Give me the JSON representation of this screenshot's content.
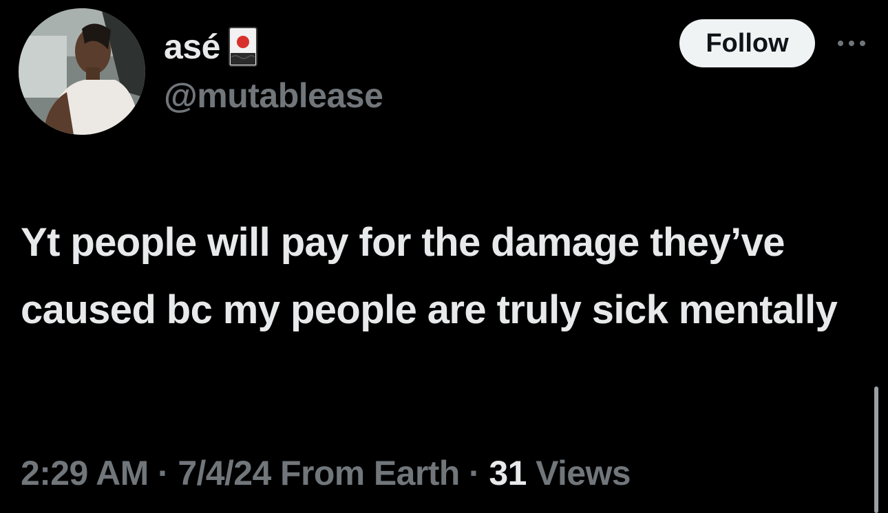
{
  "author": {
    "display_name": "asé",
    "handle": "@mutablease",
    "avatar": "profile-photo",
    "flag_icon": "hanafuda-card-icon"
  },
  "actions": {
    "follow_label": "Follow",
    "more_icon": "more-horizontal-icon"
  },
  "tweet": {
    "text": "Yt people will pay for the damage they’ve caused bc my people are truly sick mentally"
  },
  "meta": {
    "time": "2:29 AM",
    "separator": " · ",
    "date": "7/4/24",
    "location": "From Earth",
    "views_count": "31",
    "views_label": "Views"
  },
  "colors": {
    "background": "#000000",
    "primary_text": "#e7e9ea",
    "secondary_text": "#71767b",
    "follow_bg": "#eff3f4"
  }
}
